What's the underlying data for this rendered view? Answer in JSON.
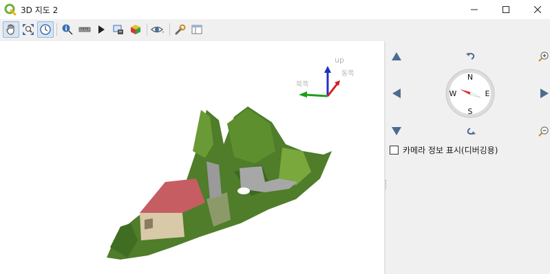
{
  "window": {
    "title": "3D 지도 2",
    "minimize_symbol": "—",
    "close_symbol": "✕"
  },
  "toolbar": {
    "buttons": [
      {
        "name": "pan-tool",
        "icon": "hand-icon",
        "active": true
      },
      {
        "name": "zoom-full",
        "icon": "zoom-full-icon",
        "active": false
      },
      {
        "name": "camera-control",
        "icon": "camera-control-icon",
        "active": true
      },
      {
        "name": "identify",
        "icon": "identify-icon",
        "active": false
      },
      {
        "name": "measure-line",
        "icon": "measure-line-icon",
        "active": false
      },
      {
        "name": "animation",
        "icon": "play-icon",
        "active": false
      },
      {
        "name": "export-scene",
        "icon": "export-scene-icon",
        "active": false
      },
      {
        "name": "map-themes",
        "icon": "map-themes-icon",
        "active": false
      },
      {
        "name": "effects",
        "icon": "eye-icon",
        "active": false
      },
      {
        "name": "options",
        "icon": "wrench-icon",
        "active": false
      },
      {
        "name": "layout",
        "icon": "layout-icon",
        "active": false
      }
    ]
  },
  "canvas": {
    "axis_labels": {
      "up": "up",
      "east": "동쪽",
      "north": "북쪽"
    },
    "colors": {
      "axis_up": "#1f2fbf",
      "axis_east": "#d22020",
      "axis_north": "#1aa01a"
    }
  },
  "navigation": {
    "compass": {
      "north": "N",
      "south": "S",
      "east": "E",
      "west": "W",
      "heading_deg": -20
    },
    "show_camera_info": {
      "label": "카메라 정보 표시(디버깅용)",
      "checked": false
    },
    "colors": {
      "arrow": "#4d6b91",
      "needle": "#e02020"
    }
  }
}
